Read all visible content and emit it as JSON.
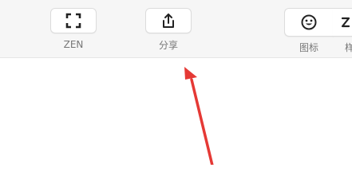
{
  "toolbar": {
    "zen": {
      "label": "ZEN",
      "icon": "fullscreen-icon"
    },
    "share": {
      "label": "分享",
      "icon": "share-upload-icon"
    },
    "icon_btn": {
      "label": "图标",
      "icon": "smiley-icon"
    },
    "partial_btn": {
      "label": "样",
      "icon": "partial-icon"
    }
  },
  "annotation": {
    "color": "#e53935",
    "icon": "red-arrow-icon"
  }
}
